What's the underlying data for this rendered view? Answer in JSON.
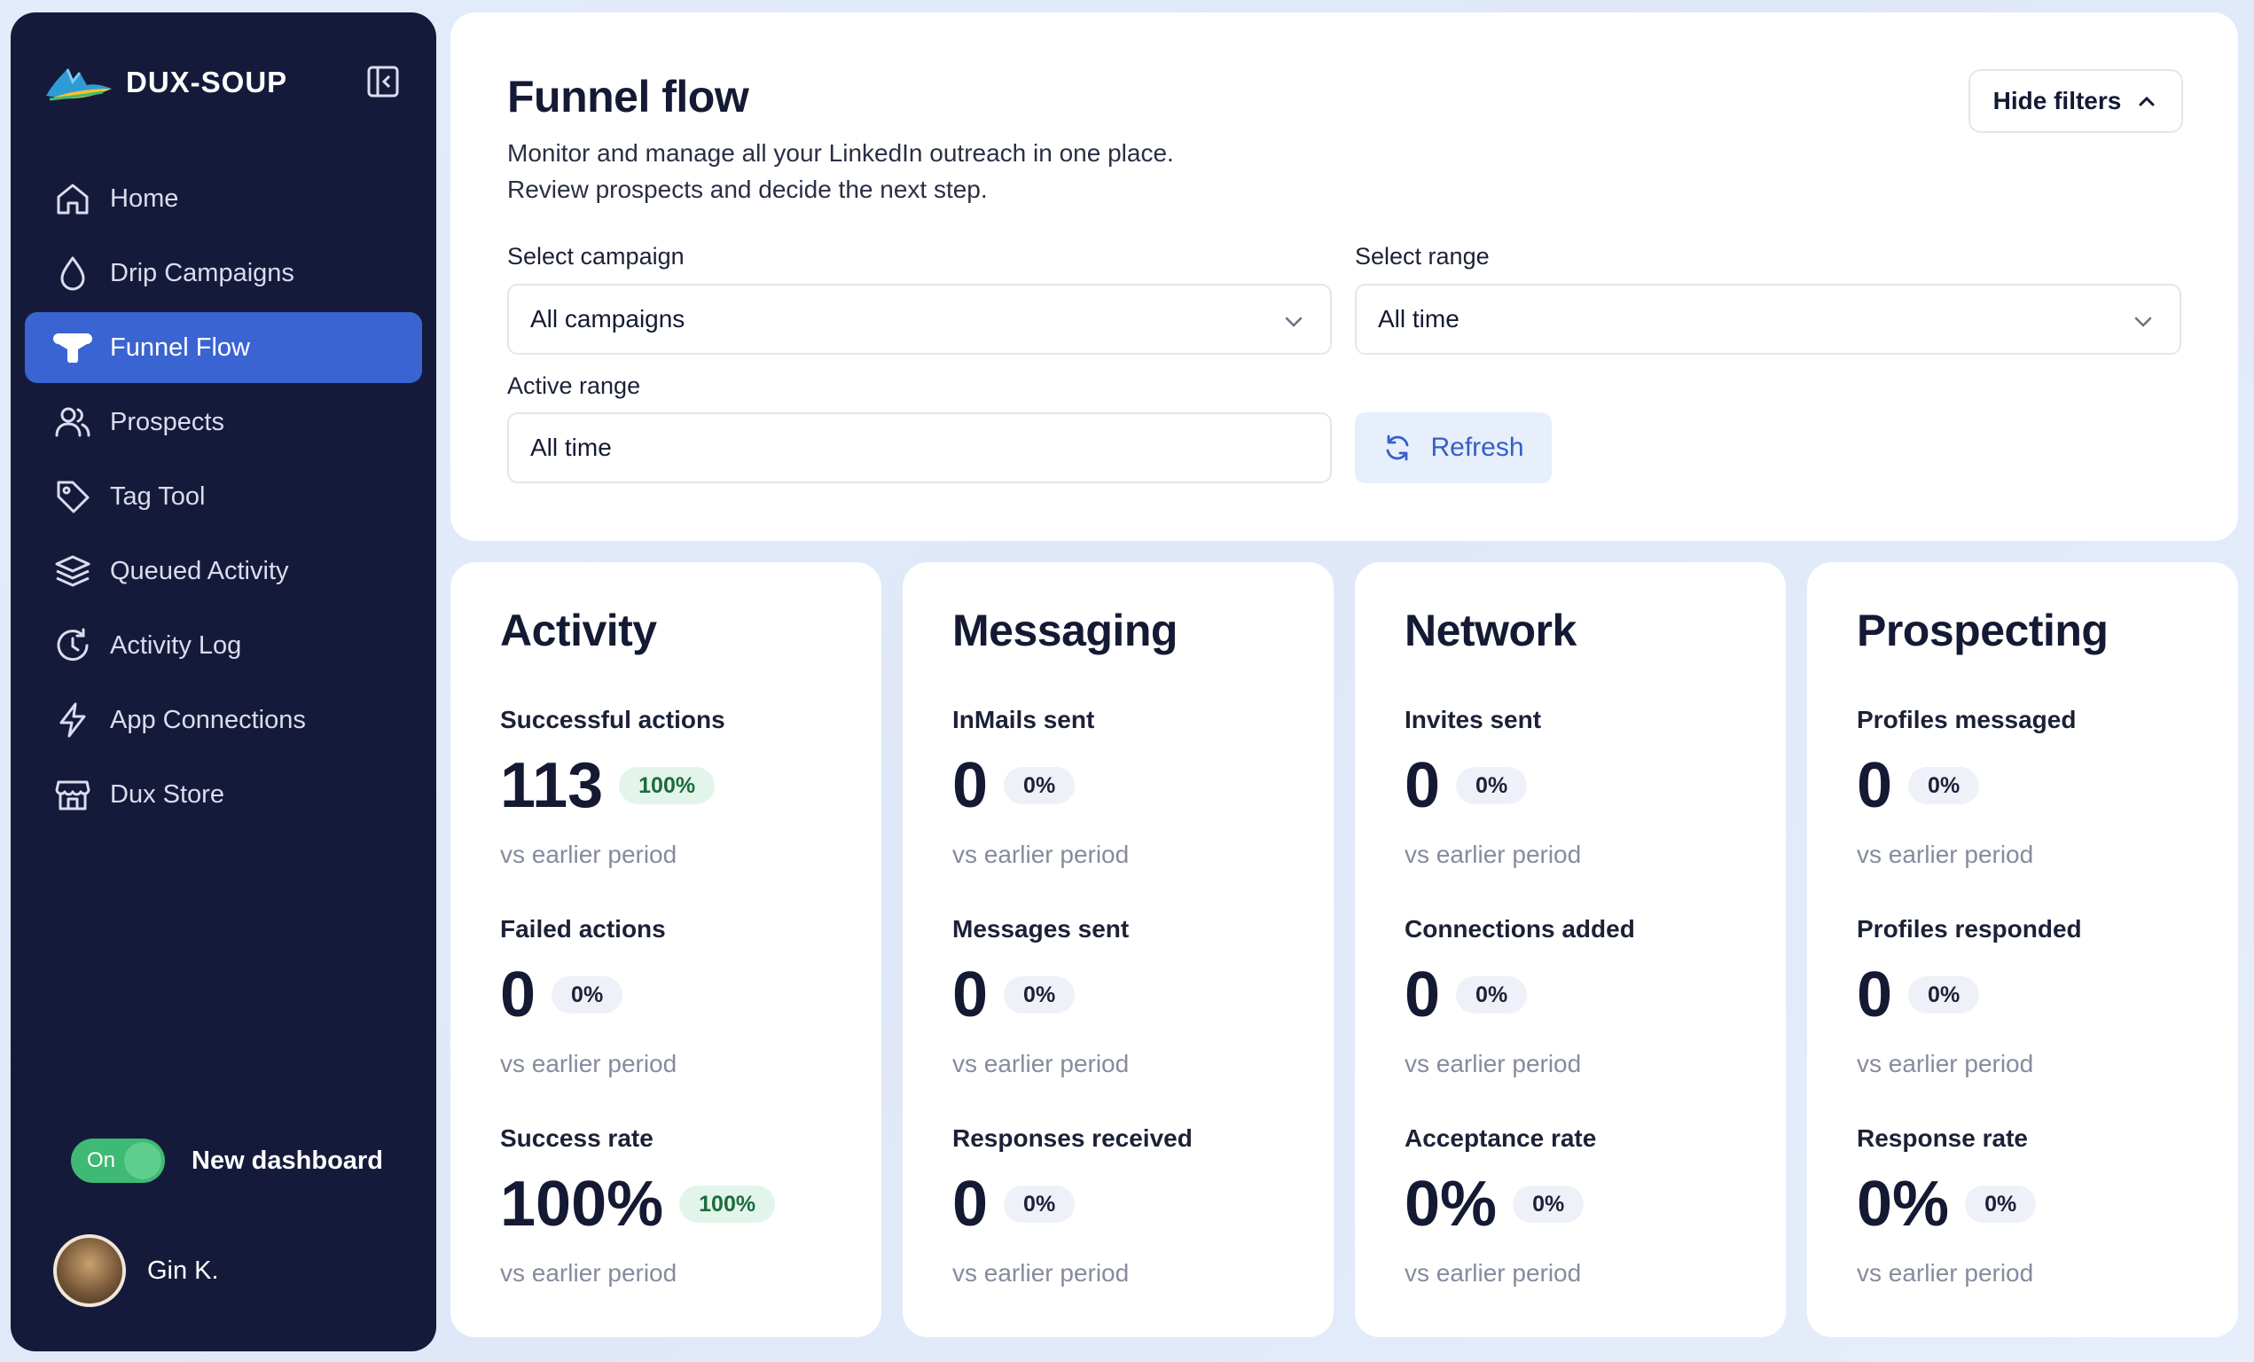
{
  "brand": {
    "name": "DUX-SOUP"
  },
  "sidebar": {
    "items": [
      {
        "label": "Home",
        "icon": "home-icon",
        "active": false
      },
      {
        "label": "Drip Campaigns",
        "icon": "drop-icon",
        "active": false
      },
      {
        "label": "Funnel Flow",
        "icon": "funnel-icon",
        "active": true
      },
      {
        "label": "Prospects",
        "icon": "users-icon",
        "active": false
      },
      {
        "label": "Tag Tool",
        "icon": "tag-icon",
        "active": false
      },
      {
        "label": "Queued Activity",
        "icon": "layers-icon",
        "active": false
      },
      {
        "label": "Activity Log",
        "icon": "history-icon",
        "active": false
      },
      {
        "label": "App Connections",
        "icon": "bolt-icon",
        "active": false
      },
      {
        "label": "Dux Store",
        "icon": "store-icon",
        "active": false
      }
    ],
    "toggle": {
      "state": "On",
      "label": "New dashboard"
    },
    "user": {
      "name": "Gin K."
    }
  },
  "header": {
    "title": "Funnel flow",
    "subtitle_line1": "Monitor and manage all your LinkedIn outreach in one place.",
    "subtitle_line2": "Review prospects and decide the next step.",
    "hide_filters_label": "Hide filters"
  },
  "filters": {
    "campaign": {
      "label": "Select campaign",
      "value": "All campaigns"
    },
    "range": {
      "label": "Select range",
      "value": "All time"
    },
    "active_range": {
      "label": "Active range",
      "value": "All time"
    },
    "refresh_label": "Refresh"
  },
  "cards": [
    {
      "title": "Activity",
      "metrics": [
        {
          "label": "Successful actions",
          "value": "113",
          "badge": "100%",
          "badge_type": "positive",
          "sub": "vs earlier period"
        },
        {
          "label": "Failed actions",
          "value": "0",
          "badge": "0%",
          "badge_type": "neutral",
          "sub": "vs earlier period"
        },
        {
          "label": "Success rate",
          "value": "100%",
          "badge": "100%",
          "badge_type": "positive",
          "sub": "vs earlier period"
        }
      ]
    },
    {
      "title": "Messaging",
      "metrics": [
        {
          "label": "InMails sent",
          "value": "0",
          "badge": "0%",
          "badge_type": "neutral",
          "sub": "vs earlier period"
        },
        {
          "label": "Messages sent",
          "value": "0",
          "badge": "0%",
          "badge_type": "neutral",
          "sub": "vs earlier period"
        },
        {
          "label": "Responses received",
          "value": "0",
          "badge": "0%",
          "badge_type": "neutral",
          "sub": "vs earlier period"
        }
      ]
    },
    {
      "title": "Network",
      "metrics": [
        {
          "label": "Invites sent",
          "value": "0",
          "badge": "0%",
          "badge_type": "neutral",
          "sub": "vs earlier period"
        },
        {
          "label": "Connections added",
          "value": "0",
          "badge": "0%",
          "badge_type": "neutral",
          "sub": "vs earlier period"
        },
        {
          "label": "Acceptance rate",
          "value": "0%",
          "badge": "0%",
          "badge_type": "neutral",
          "sub": "vs earlier period"
        }
      ]
    },
    {
      "title": "Prospecting",
      "metrics": [
        {
          "label": "Profiles messaged",
          "value": "0",
          "badge": "0%",
          "badge_type": "neutral",
          "sub": "vs earlier period"
        },
        {
          "label": "Profiles responded",
          "value": "0",
          "badge": "0%",
          "badge_type": "neutral",
          "sub": "vs earlier period"
        },
        {
          "label": "Response rate",
          "value": "0%",
          "badge": "0%",
          "badge_type": "neutral",
          "sub": "vs earlier period"
        }
      ]
    }
  ],
  "colors": {
    "sidebar_bg": "#161a3a",
    "accent": "#3a64d1",
    "toggle_on": "#3fba74",
    "positive_badge_bg": "#e3f5ea",
    "neutral_badge_bg": "#eef1f8"
  }
}
